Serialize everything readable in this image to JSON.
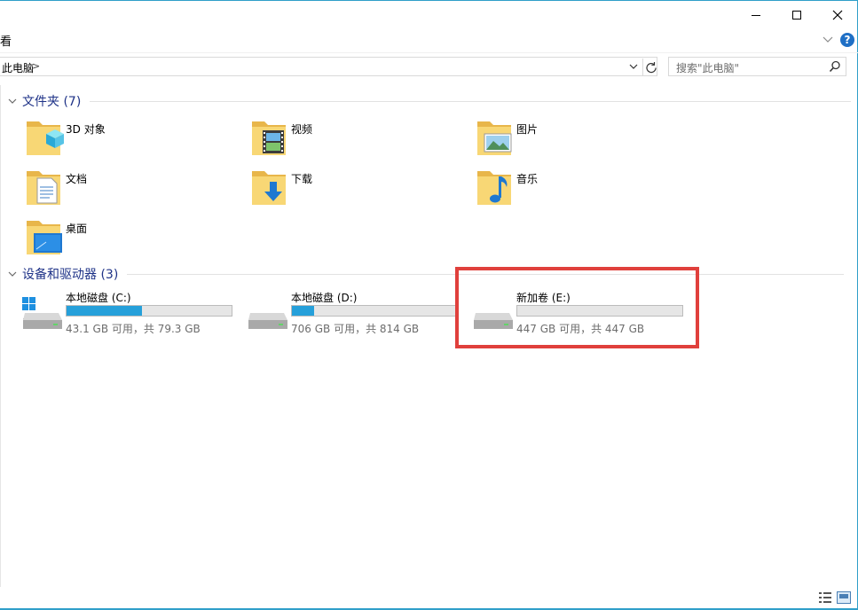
{
  "window": {
    "ribbon_fragment": "看",
    "minimize_label": "最小化",
    "maximize_label": "最大化",
    "close_label": "关闭",
    "help_label": "?"
  },
  "address": {
    "path": "此电脑",
    "separator": ">",
    "search_placeholder": "搜索\"此电脑\""
  },
  "folders_group": {
    "title": "文件夹 (7)",
    "items": [
      {
        "label": "3D 对象",
        "icon": "folder-3d-objects-icon"
      },
      {
        "label": "视频",
        "icon": "folder-videos-icon"
      },
      {
        "label": "图片",
        "icon": "folder-pictures-icon"
      },
      {
        "label": "文档",
        "icon": "folder-documents-icon"
      },
      {
        "label": "下载",
        "icon": "folder-downloads-icon"
      },
      {
        "label": "音乐",
        "icon": "folder-music-icon"
      },
      {
        "label": "桌面",
        "icon": "folder-desktop-icon"
      }
    ]
  },
  "drives_group": {
    "title": "设备和驱动器 (3)",
    "items": [
      {
        "name": "本地磁盘 (C:)",
        "info": "43.1 GB 可用，共 79.3 GB",
        "used_fraction": 0.456,
        "icon": "system-drive-icon"
      },
      {
        "name": "本地磁盘 (D:)",
        "info": "706 GB 可用，共 814 GB",
        "used_fraction": 0.133,
        "icon": "hard-drive-icon"
      },
      {
        "name": "新加卷 (E:)",
        "info": "447 GB 可用，共 447 GB",
        "used_fraction": 0.0,
        "icon": "hard-drive-icon"
      }
    ]
  },
  "colors": {
    "accent": "#26a0da",
    "group_title": "#1e3287",
    "highlight": "#e0403c",
    "window_border": "#2f9fc9"
  },
  "status": {
    "view_buttons": [
      "details-view-icon",
      "large-icons-view-icon"
    ]
  }
}
